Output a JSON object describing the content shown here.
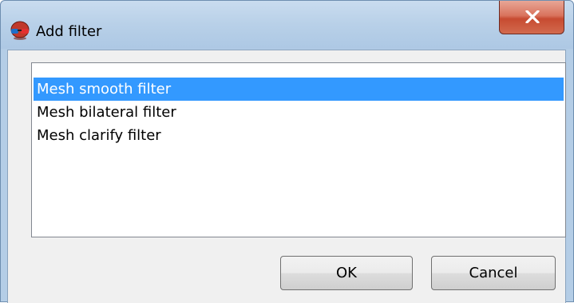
{
  "window": {
    "title": "Add filter",
    "app_icon": "red-blue-glasses-icon",
    "close_icon": "close-icon",
    "close_button_color": "#c74b31",
    "title_bar_color": "#b8d0e8"
  },
  "filter_list": {
    "items": [
      {
        "label": "Mesh smooth filter",
        "selected": true
      },
      {
        "label": "Mesh bilateral filter",
        "selected": false
      },
      {
        "label": "Mesh clarify filter",
        "selected": false
      }
    ],
    "selection_color": "#3399ff"
  },
  "buttons": {
    "ok_label": "OK",
    "cancel_label": "Cancel"
  }
}
